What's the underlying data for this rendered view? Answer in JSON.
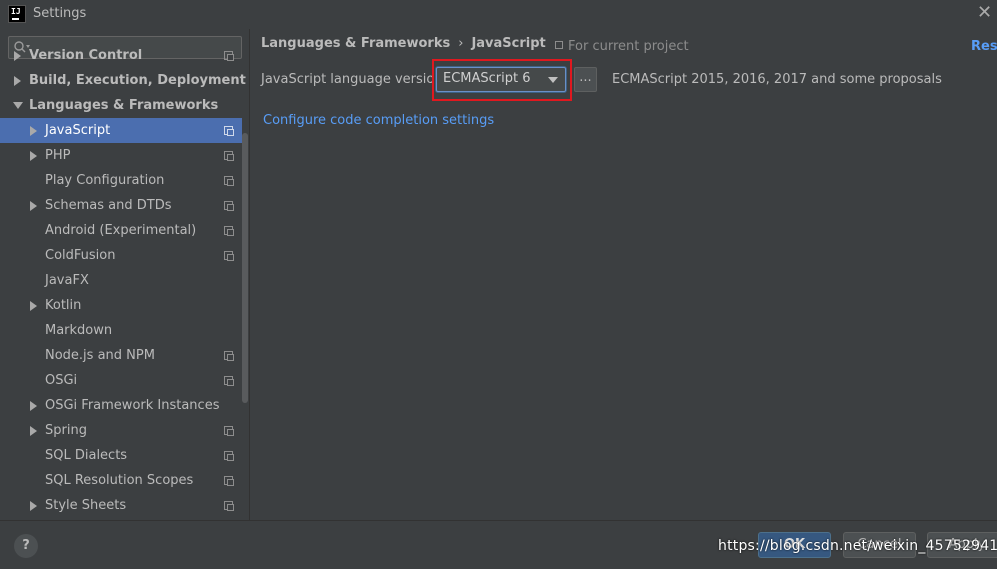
{
  "window": {
    "title": "Settings",
    "app_logo_text": "IJ",
    "close_glyph": "✕"
  },
  "search": {
    "placeholder": ""
  },
  "sidebar": {
    "items": [
      {
        "label": "Version Control",
        "level": 0,
        "arrow": "right",
        "bold": true,
        "project_icon": true,
        "selected": false
      },
      {
        "label": "Build, Execution, Deployment",
        "level": 0,
        "arrow": "right",
        "bold": true,
        "project_icon": false,
        "selected": false
      },
      {
        "label": "Languages & Frameworks",
        "level": 0,
        "arrow": "down",
        "bold": true,
        "project_icon": false,
        "selected": false
      },
      {
        "label": "JavaScript",
        "level": 1,
        "arrow": "right",
        "bold": false,
        "project_icon": true,
        "selected": true
      },
      {
        "label": "PHP",
        "level": 1,
        "arrow": "right",
        "bold": false,
        "project_icon": true,
        "selected": false
      },
      {
        "label": "Play Configuration",
        "level": 1,
        "arrow": "none",
        "bold": false,
        "project_icon": true,
        "selected": false
      },
      {
        "label": "Schemas and DTDs",
        "level": 1,
        "arrow": "right",
        "bold": false,
        "project_icon": true,
        "selected": false
      },
      {
        "label": "Android (Experimental)",
        "level": 1,
        "arrow": "none",
        "bold": false,
        "project_icon": true,
        "selected": false
      },
      {
        "label": "ColdFusion",
        "level": 1,
        "arrow": "none",
        "bold": false,
        "project_icon": true,
        "selected": false
      },
      {
        "label": "JavaFX",
        "level": 1,
        "arrow": "none",
        "bold": false,
        "project_icon": false,
        "selected": false
      },
      {
        "label": "Kotlin",
        "level": 1,
        "arrow": "right",
        "bold": false,
        "project_icon": false,
        "selected": false
      },
      {
        "label": "Markdown",
        "level": 1,
        "arrow": "none",
        "bold": false,
        "project_icon": false,
        "selected": false
      },
      {
        "label": "Node.js and NPM",
        "level": 1,
        "arrow": "none",
        "bold": false,
        "project_icon": true,
        "selected": false
      },
      {
        "label": "OSGi",
        "level": 1,
        "arrow": "none",
        "bold": false,
        "project_icon": true,
        "selected": false
      },
      {
        "label": "OSGi Framework Instances",
        "level": 1,
        "arrow": "right",
        "bold": false,
        "project_icon": false,
        "selected": false
      },
      {
        "label": "Spring",
        "level": 1,
        "arrow": "right",
        "bold": false,
        "project_icon": true,
        "selected": false
      },
      {
        "label": "SQL Dialects",
        "level": 1,
        "arrow": "none",
        "bold": false,
        "project_icon": true,
        "selected": false
      },
      {
        "label": "SQL Resolution Scopes",
        "level": 1,
        "arrow": "none",
        "bold": false,
        "project_icon": true,
        "selected": false
      },
      {
        "label": "Style Sheets",
        "level": 1,
        "arrow": "right",
        "bold": false,
        "project_icon": true,
        "selected": false
      }
    ]
  },
  "content": {
    "breadcrumb": {
      "parent": "Languages & Frameworks",
      "separator": "›",
      "current": "JavaScript"
    },
    "scope_note": "For current project",
    "reset_label": "Reset",
    "language_version": {
      "label": "JavaScript language version",
      "selected": "ECMAScript 6",
      "more_label": "...",
      "description": "ECMAScript 2015, 2016, 2017 and some proposals"
    },
    "config_link": "Configure code completion settings"
  },
  "footer": {
    "help_label": "?",
    "ok_label": "OK",
    "cancel_label": "Cancel",
    "apply_label": "Apply"
  },
  "watermark": "https://blog.csdn.net/weixin_45752941",
  "colors": {
    "background": "#3c3f41",
    "selection": "#4b6eaf",
    "link": "#589df6",
    "highlight_box": "#e0181f",
    "ok_button": "#365880"
  }
}
